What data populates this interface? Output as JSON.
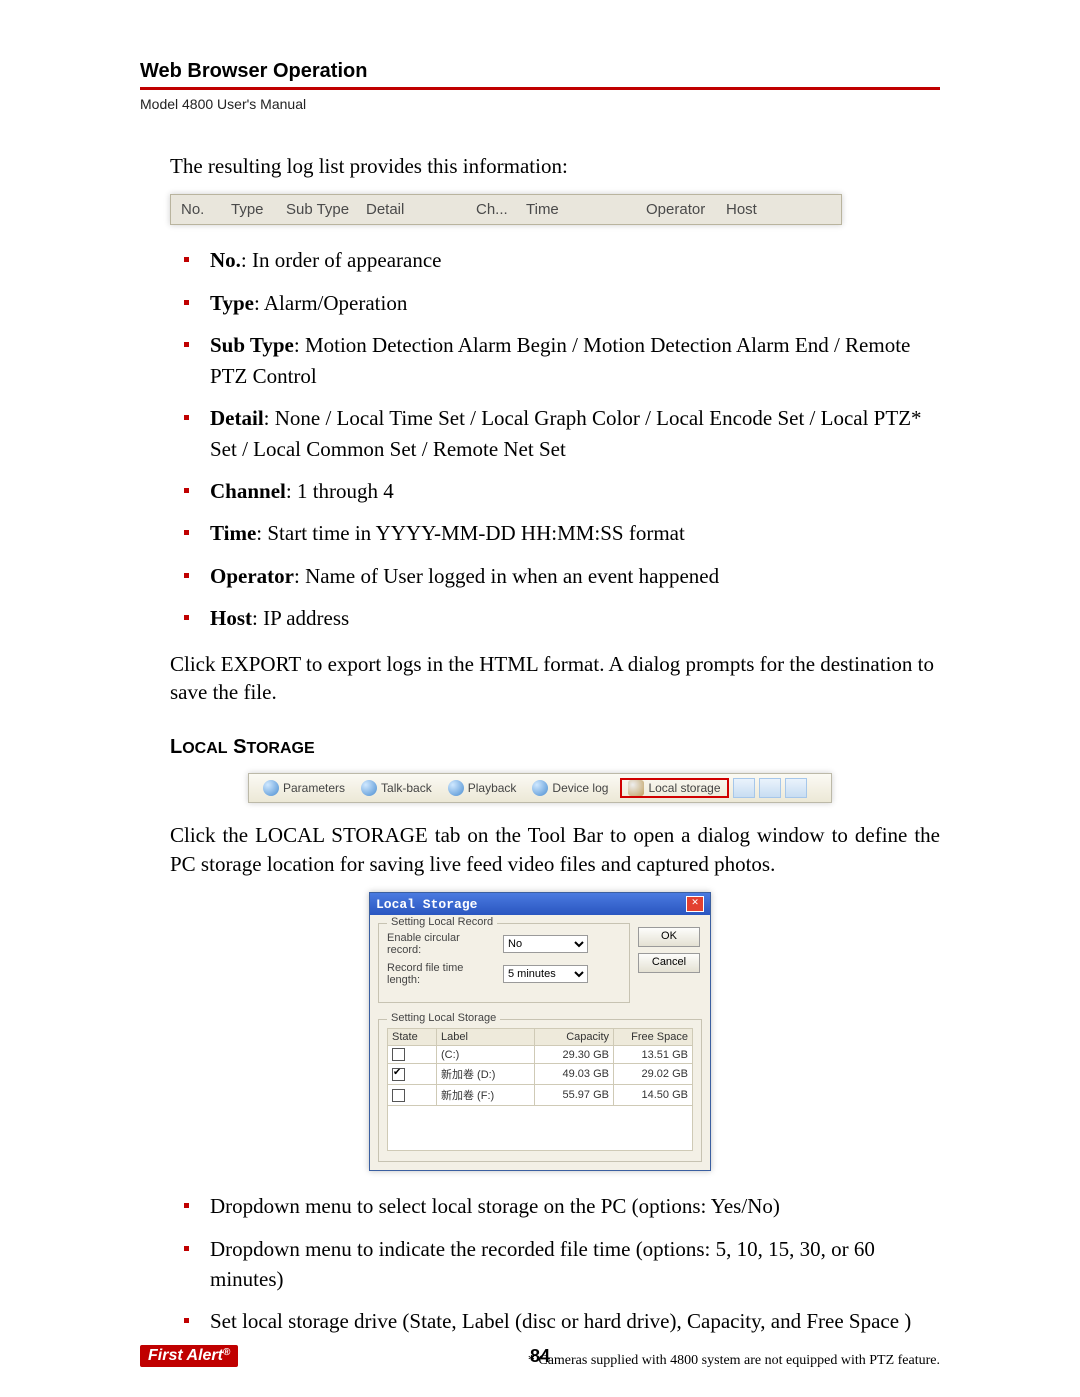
{
  "chapter_title": "Web Browser Operation",
  "subtitle": "Model 4800 User's Manual",
  "intro": "The resulting log list provides this information:",
  "log_columns": [
    "No.",
    "Type",
    "Sub Type",
    "Detail",
    "Ch...",
    "Time",
    "Operator",
    "Host"
  ],
  "field_bullets": [
    {
      "label": "No.",
      "desc": ": In order of appearance"
    },
    {
      "label": "Type",
      "desc": ": Alarm/Operation"
    },
    {
      "label": "Sub Type",
      "desc": ": Motion Detection Alarm Begin / Motion Detection Alarm End / Remote PTZ Control"
    },
    {
      "label": "Detail",
      "desc": ": None / Local Time Set / Local Graph Color / Local Encode Set / Local PTZ* Set / Local Common Set / Remote Net Set"
    },
    {
      "label": "Channel",
      "desc": ": 1 through 4"
    },
    {
      "label": "Time",
      "desc": ": Start time in YYYY-MM-DD HH:MM:SS format"
    },
    {
      "label": "Operator",
      "desc": ": Name of User logged in when an event happened"
    },
    {
      "label": "Host",
      "desc": ": IP address"
    }
  ],
  "export_text": "Click EXPORT to export logs in the HTML format. A dialog prompts for the destination to save the file.",
  "section_heading": "Local Storage",
  "toolbar": {
    "items": [
      "Parameters",
      "Talk-back",
      "Playback",
      "Device log",
      "Local storage"
    ]
  },
  "local_storage_text": "Click the LOCAL STORAGE tab on the Tool Bar to open a dialog window to define the PC storage location for saving live feed video files and captured photos.",
  "dialog": {
    "title": "Local Storage",
    "group1_legend": "Setting Local Record",
    "enable_label": "Enable circular record:",
    "enable_value": "No",
    "length_label": "Record file time length:",
    "length_value": "5 minutes",
    "ok": "OK",
    "cancel": "Cancel",
    "group2_legend": "Setting Local Storage",
    "table_headers": [
      "State",
      "Label",
      "Capacity",
      "Free Space"
    ],
    "rows": [
      {
        "checked": false,
        "label": "(C:)",
        "capacity": "29.30 GB",
        "free": "13.51 GB"
      },
      {
        "checked": true,
        "label": "新加卷 (D:)",
        "capacity": "49.03 GB",
        "free": "29.02 GB"
      },
      {
        "checked": false,
        "label": "新加卷 (F:)",
        "capacity": "55.97 GB",
        "free": "14.50 GB"
      }
    ]
  },
  "storage_bullets": [
    "Dropdown menu to select local storage on the PC (options: Yes/No)",
    "Dropdown menu to indicate the recorded file time (options: 5, 10, 15, 30, or 60 minutes)",
    "Set local storage drive (State, Label (disc or hard drive), Capacity, and Free Space )"
  ],
  "footnote": "* Cameras supplied with 4800 system are not equipped with PTZ feature.",
  "logo_text": "First Alert",
  "page_number": "84"
}
